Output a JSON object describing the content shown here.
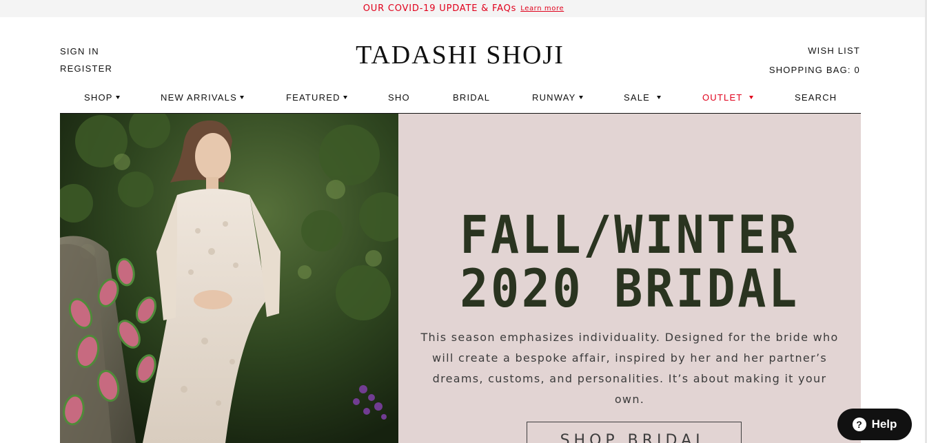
{
  "announcement": {
    "message": "OUR COVID-19 UPDATE & FAQs",
    "link": "Learn more",
    "color": "#e0001b"
  },
  "header": {
    "sign_in": "SIGN IN",
    "register": "REGISTER",
    "logo": "TADASHI SHOJI",
    "wish_list": "WISH LIST",
    "shopping_bag": "SHOPPING BAG: 0"
  },
  "nav": {
    "items": [
      {
        "label": "SHOP",
        "has_dropdown": true
      },
      {
        "label": "NEW ARRIVALS",
        "has_dropdown": true
      },
      {
        "label": "FEATURED",
        "has_dropdown": true
      },
      {
        "label": "SHO",
        "has_dropdown": false
      },
      {
        "label": "BRIDAL",
        "has_dropdown": false
      },
      {
        "label": "RUNWAY",
        "has_dropdown": true
      },
      {
        "label": "SALE",
        "has_dropdown": true
      },
      {
        "label": "OUTLET",
        "has_dropdown": true,
        "color": "#e0001b"
      },
      {
        "label": "SEARCH",
        "has_dropdown": false
      }
    ]
  },
  "hero": {
    "headline_line1": "FALL/WINTER",
    "headline_line2": "2020 BRIDAL",
    "body": "This season emphasizes individuality. Designed for the bride who will create a bespoke affair, inspired by her and her partner’s dreams, customs, and personalities. It’s about making it your own.",
    "button": "SHOP BRIDAL",
    "background": "#e2d4d3",
    "headline_color": "#2a3420"
  },
  "help_widget": {
    "label": "Help",
    "icon": "question-icon"
  }
}
